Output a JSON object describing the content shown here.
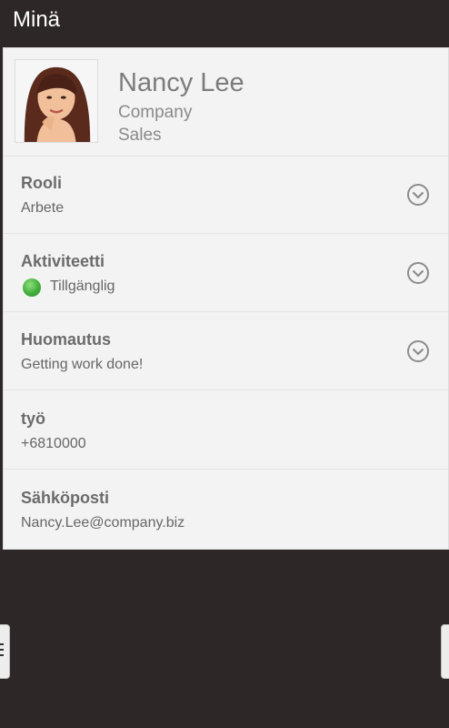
{
  "app": {
    "title": "Minä"
  },
  "profile": {
    "name": "Nancy Lee",
    "company": "Company",
    "department": "Sales"
  },
  "fields": [
    {
      "label": "Rooli",
      "value": "Arbete",
      "icon": "chevron-down-circle-icon"
    },
    {
      "label": "Aktiviteetti",
      "value": "Tillgänglig",
      "status_color": "#3fae3a",
      "icon": "chevron-down-circle-icon"
    },
    {
      "label": "Huomautus",
      "value": "Getting work done!",
      "icon": "chevron-down-circle-icon"
    },
    {
      "label": "työ",
      "value": "+6810000"
    },
    {
      "label": "Sähköposti",
      "value": "Nancy.Lee@company.biz"
    }
  ]
}
